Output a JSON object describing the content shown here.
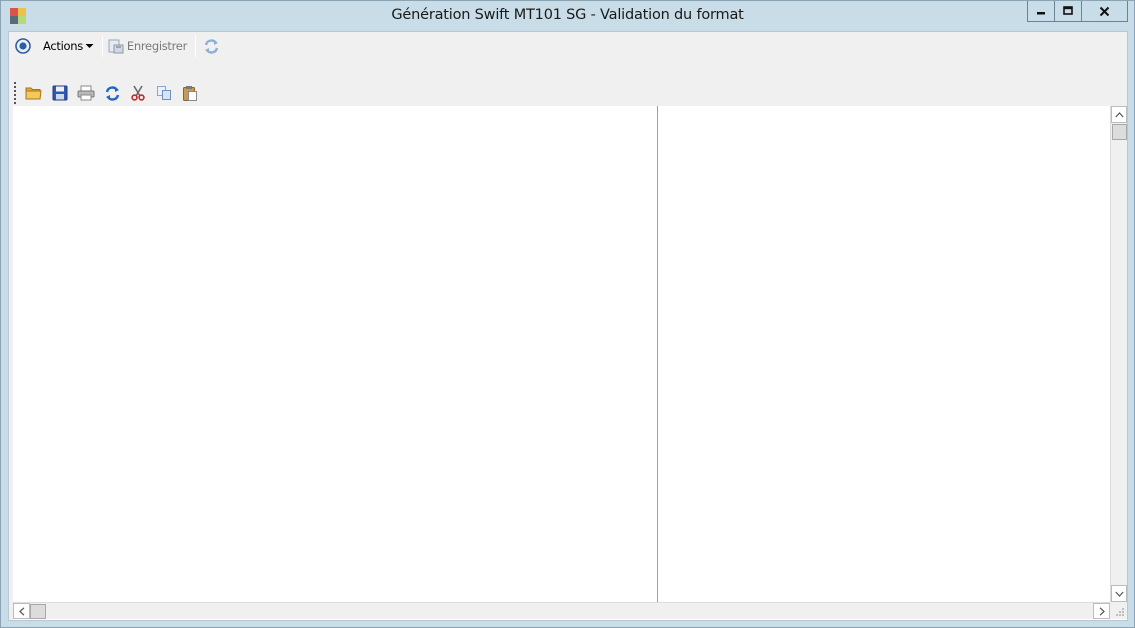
{
  "window": {
    "title": "Génération Swift MT101 SG -  Validation du format",
    "controls": {
      "minimize": "minimize-icon",
      "maximize": "maximize-icon",
      "close": "close-icon"
    }
  },
  "toolbar_primary": {
    "actions_label": "Actions",
    "save_label": "Enregistrer"
  },
  "toolbar_secondary": {
    "icons": [
      "folder-open-icon",
      "save-icon",
      "print-icon",
      "refresh-icon",
      "cut-icon",
      "copy-icon",
      "paste-icon"
    ]
  },
  "colors": {
    "chrome": "#c9dde8",
    "toolbar": "#f0f0f0",
    "pane": "#ffffff",
    "accent": "#2b5fa8"
  }
}
